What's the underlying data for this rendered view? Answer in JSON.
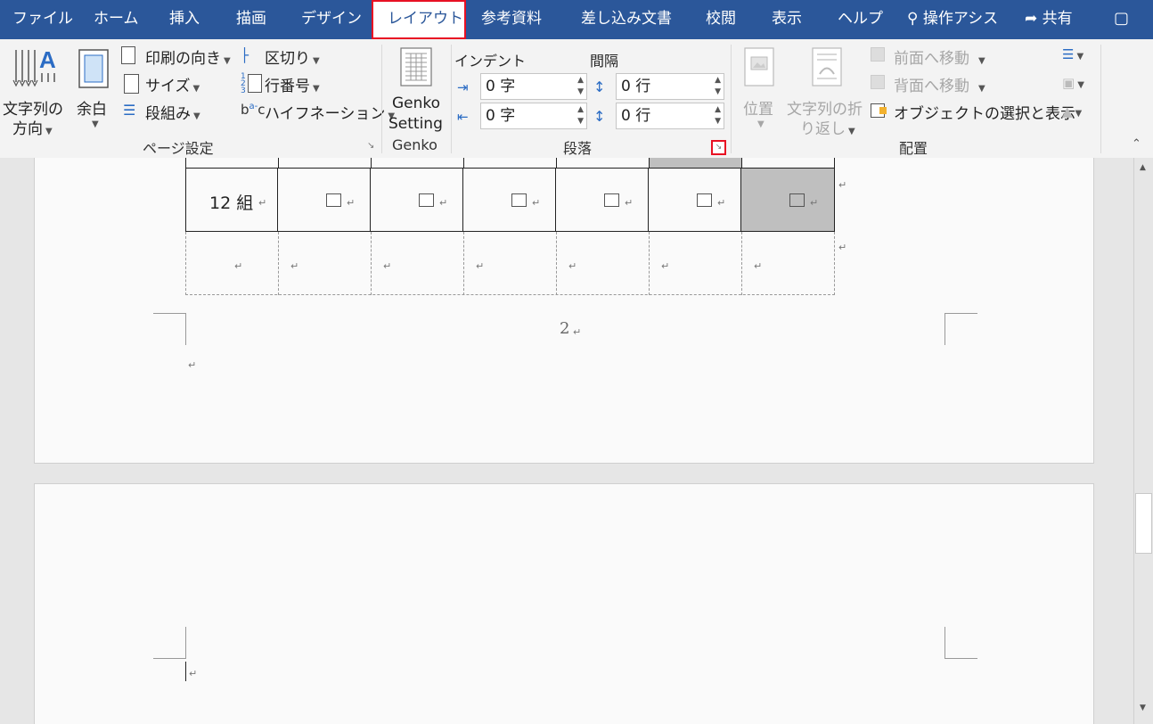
{
  "tabs": {
    "file": "ファイル",
    "home": "ホーム",
    "insert": "挿入",
    "draw": "描画",
    "design": "デザイン",
    "layout": "レイアウト",
    "references": "参考資料",
    "mailings": "差し込み文書",
    "review": "校閲",
    "view": "表示",
    "help": "ヘルプ",
    "tell_me": "操作アシス",
    "share": "共有"
  },
  "page_setup": {
    "text_direction_line1": "文字列の",
    "text_direction_line2": "方向",
    "margins": "余白",
    "orientation": "印刷の向き",
    "size": "サイズ",
    "columns": "段組み",
    "breaks": "区切り",
    "line_numbers": "行番号",
    "hyphenation": "ハイフネーション",
    "group_label": "ページ設定"
  },
  "genko": {
    "button_line1": "Genko",
    "button_line2": "Setting",
    "group_label": "Genko"
  },
  "paragraph": {
    "indent_label": "インデント",
    "spacing_label": "間隔",
    "indent_left": "0 字",
    "indent_right": "0 字",
    "spacing_before": "0 行",
    "spacing_after": "0 行",
    "group_label": "段落"
  },
  "arrange": {
    "position": "位置",
    "wrap_line1": "文字列の折",
    "wrap_line2": "り返し",
    "bring_forward": "前面へ移動",
    "send_backward": "背面へ移動",
    "selection_pane": "オブジェクトの選択と表示",
    "group_label": "配置"
  },
  "document": {
    "row_label": "12 組",
    "page_number": "2",
    "paragraph_mark": "↵"
  },
  "colors": {
    "tab_bar": "#2b579a",
    "highlight": "#e81123",
    "shaded_cell": "#bfbfbf"
  }
}
